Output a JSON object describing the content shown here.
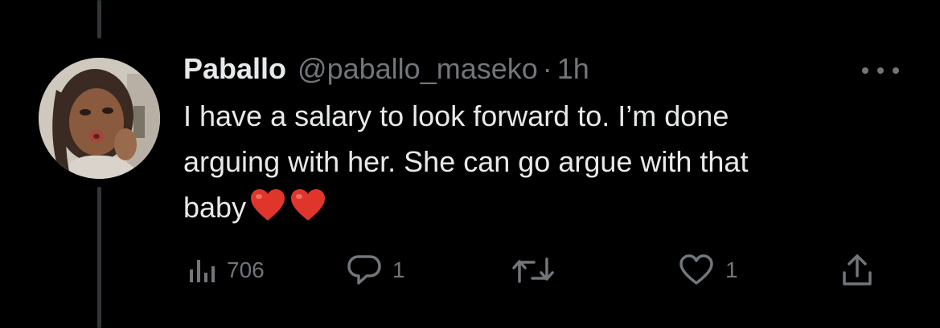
{
  "tweet": {
    "display_name": "Paballo",
    "handle": "@paballo_maseko",
    "separator": "·",
    "time": "1h",
    "text_lines": [
      "I have a salary to look forward to. I’m done",
      "arguing with her. She can go argue with that",
      "baby"
    ],
    "emojis": [
      "red-heart",
      "red-heart"
    ]
  },
  "actions": {
    "views": "706",
    "replies": "1",
    "retweets": "",
    "likes": "1"
  },
  "colors": {
    "background": "#000000",
    "text_primary": "#e7e9ea",
    "text_secondary": "#71767b",
    "thread_line": "#333639",
    "heart_emoji": "#e0352b"
  },
  "icons": {
    "views": "bar-chart-icon",
    "reply": "speech-bubble-icon",
    "retweet": "retweet-arrows-icon",
    "like": "heart-outline-icon",
    "share": "share-upload-icon",
    "more": "more-dots-icon"
  }
}
